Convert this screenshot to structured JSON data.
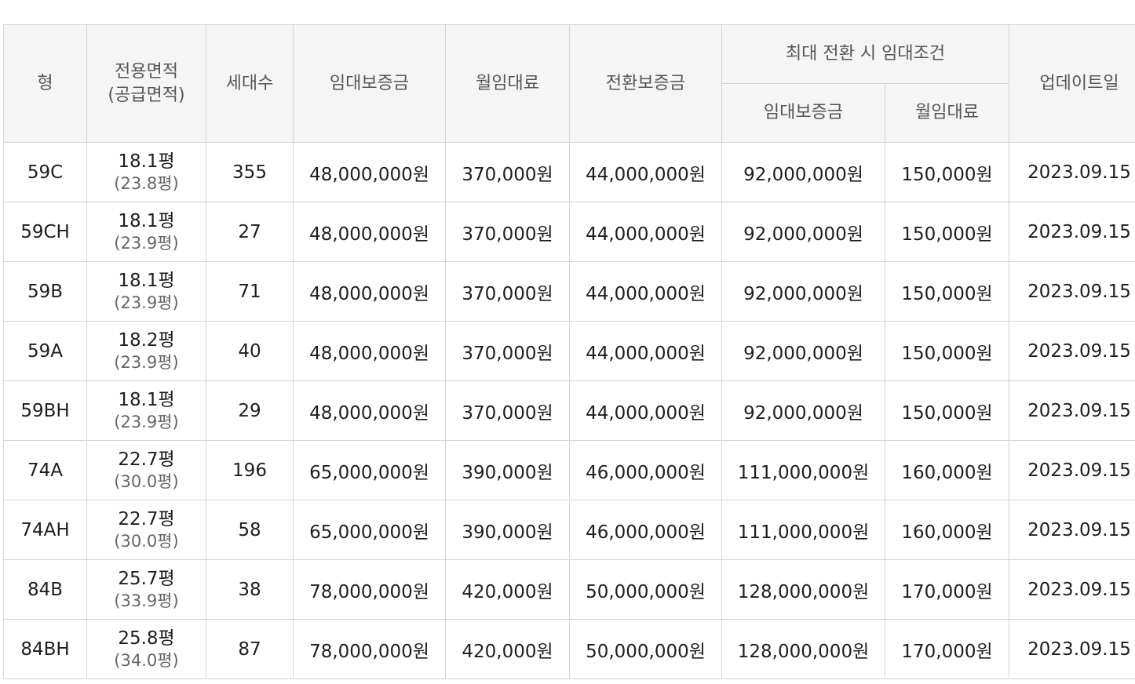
{
  "header": {
    "type": "형",
    "area_line1": "전용면적",
    "area_line2": "(공급면적)",
    "households": "세대수",
    "deposit": "임대보증금",
    "monthly_rent": "월임대료",
    "conversion_deposit": "전환보증금",
    "max_conversion_group": "최대 전환 시 임대조건",
    "max_deposit": "임대보증금",
    "max_monthly_rent": "월임대료",
    "updated": "업데이트일"
  },
  "rows": [
    {
      "type": "59C",
      "area": "18.1평",
      "supply_area": "(23.8평)",
      "households": "355",
      "deposit": "48,000,000원",
      "monthly": "370,000원",
      "conversion": "44,000,000원",
      "max_deposit": "92,000,000원",
      "max_monthly": "150,000원",
      "updated": "2023.09.15"
    },
    {
      "type": "59CH",
      "area": "18.1평",
      "supply_area": "(23.9평)",
      "households": "27",
      "deposit": "48,000,000원",
      "monthly": "370,000원",
      "conversion": "44,000,000원",
      "max_deposit": "92,000,000원",
      "max_monthly": "150,000원",
      "updated": "2023.09.15"
    },
    {
      "type": "59B",
      "area": "18.1평",
      "supply_area": "(23.9평)",
      "households": "71",
      "deposit": "48,000,000원",
      "monthly": "370,000원",
      "conversion": "44,000,000원",
      "max_deposit": "92,000,000원",
      "max_monthly": "150,000원",
      "updated": "2023.09.15"
    },
    {
      "type": "59A",
      "area": "18.2평",
      "supply_area": "(23.9평)",
      "households": "40",
      "deposit": "48,000,000원",
      "monthly": "370,000원",
      "conversion": "44,000,000원",
      "max_deposit": "92,000,000원",
      "max_monthly": "150,000원",
      "updated": "2023.09.15"
    },
    {
      "type": "59BH",
      "area": "18.1평",
      "supply_area": "(23.9평)",
      "households": "29",
      "deposit": "48,000,000원",
      "monthly": "370,000원",
      "conversion": "44,000,000원",
      "max_deposit": "92,000,000원",
      "max_monthly": "150,000원",
      "updated": "2023.09.15"
    },
    {
      "type": "74A",
      "area": "22.7평",
      "supply_area": "(30.0평)",
      "households": "196",
      "deposit": "65,000,000원",
      "monthly": "390,000원",
      "conversion": "46,000,000원",
      "max_deposit": "111,000,000원",
      "max_monthly": "160,000원",
      "updated": "2023.09.15"
    },
    {
      "type": "74AH",
      "area": "22.7평",
      "supply_area": "(30.0평)",
      "households": "58",
      "deposit": "65,000,000원",
      "monthly": "390,000원",
      "conversion": "46,000,000원",
      "max_deposit": "111,000,000원",
      "max_monthly": "160,000원",
      "updated": "2023.09.15"
    },
    {
      "type": "84B",
      "area": "25.7평",
      "supply_area": "(33.9평)",
      "households": "38",
      "deposit": "78,000,000원",
      "monthly": "420,000원",
      "conversion": "50,000,000원",
      "max_deposit": "128,000,000원",
      "max_monthly": "170,000원",
      "updated": "2023.09.15"
    },
    {
      "type": "84BH",
      "area": "25.8평",
      "supply_area": "(34.0평)",
      "households": "87",
      "deposit": "78,000,000원",
      "monthly": "420,000원",
      "conversion": "50,000,000원",
      "max_deposit": "128,000,000원",
      "max_monthly": "170,000원",
      "updated": "2023.09.15"
    }
  ]
}
